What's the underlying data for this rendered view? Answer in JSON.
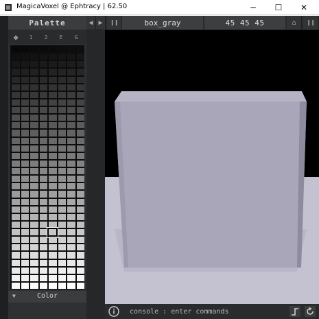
{
  "window": {
    "title": "MagicaVoxel @ Ephtracy | 62.50",
    "minimize_label": "─",
    "maximize_label": "☐",
    "close_label": "✕"
  },
  "palette": {
    "header": "Palette",
    "tabs": [
      "✥",
      "1",
      "2",
      "E",
      "G"
    ],
    "selected_index": 196,
    "footer_label": "Color",
    "footer_arrow": "▼"
  },
  "toolbar": {
    "prev_label": "◀",
    "next_label": "▶",
    "pause_label": "❙❙",
    "file_name": "box_gray",
    "dimensions": "45 45 45",
    "view_label": "⌂",
    "panel_label": "❙❙"
  },
  "console": {
    "placeholder": "console : enter commands",
    "info_icon": "i"
  },
  "colors": {
    "cube_top": "#b6b3c4",
    "cube_front": "#a9a6b9",
    "cube_side": "#8e8ba0",
    "floor": "#c4c1d1",
    "sky": "#000000"
  }
}
